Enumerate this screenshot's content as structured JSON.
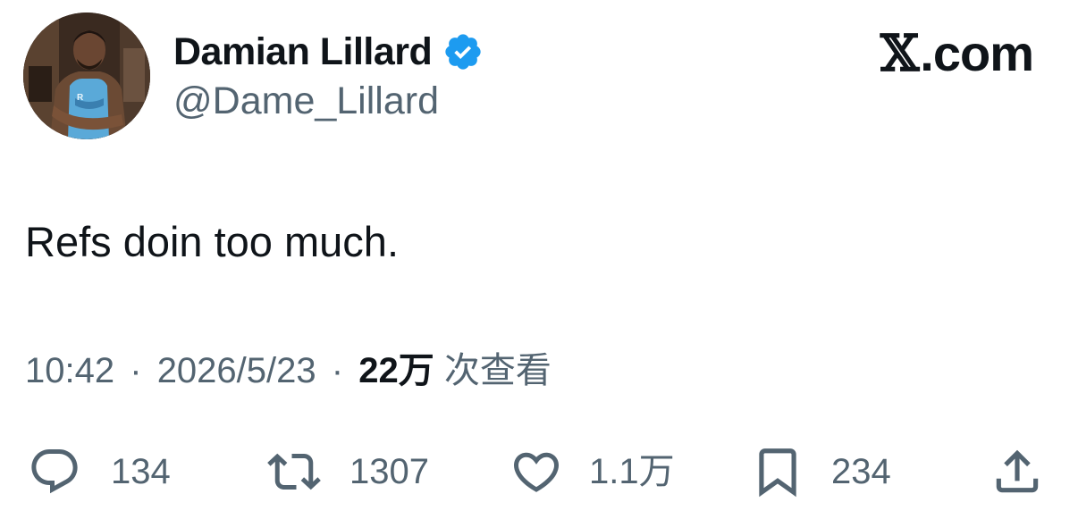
{
  "author": {
    "display_name": "Damian Lillard",
    "handle": "@Dame_Lillard",
    "verified_icon": "verified-badge-icon",
    "avatar": "profile-photo"
  },
  "brand": {
    "label": ".com",
    "glyph": "𝕏"
  },
  "tweet": {
    "text": "Refs doin too much."
  },
  "meta": {
    "time": "10:42",
    "separator": "·",
    "date": "2026/5/23",
    "views_count": "22万",
    "views_label": "次查看"
  },
  "actions": {
    "reply": {
      "icon": "reply-icon",
      "count": "134"
    },
    "repost": {
      "icon": "repost-icon",
      "count": "1307"
    },
    "like": {
      "icon": "heart-icon",
      "count": "1.1万"
    },
    "bookmark": {
      "icon": "bookmark-icon",
      "count": "234"
    },
    "share": {
      "icon": "share-icon"
    }
  },
  "colors": {
    "text_primary": "#0f1419",
    "text_secondary": "#536471",
    "verified_blue": "#1d9bf0",
    "background": "#ffffff"
  }
}
